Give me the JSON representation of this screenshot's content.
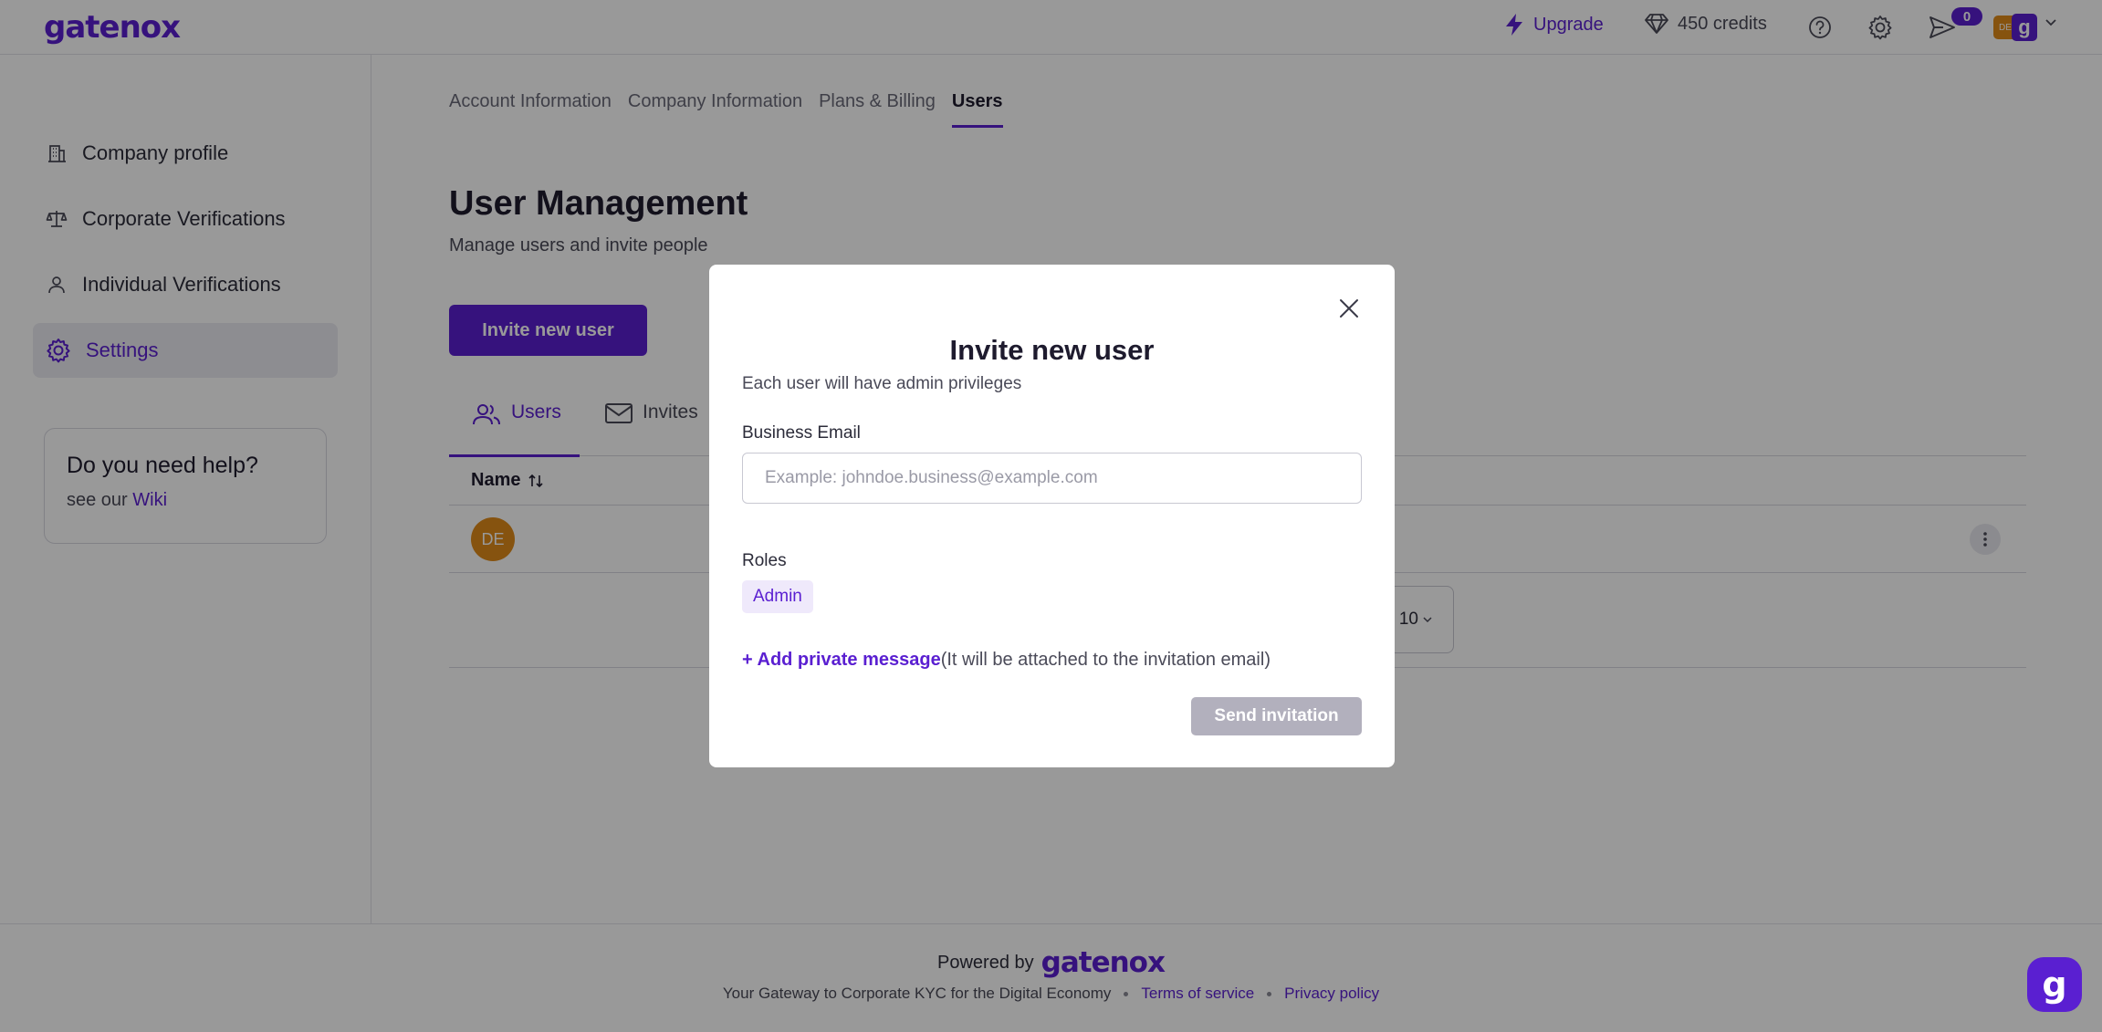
{
  "brand": {
    "name": "gatenox"
  },
  "topbar": {
    "upgrade_label": "Upgrade",
    "credits_label": "450 credits",
    "notification_count": "0",
    "avatar_initials": "DE",
    "avatar_brand_letter": "g"
  },
  "sidebar": {
    "items": [
      {
        "label": "Company profile",
        "icon": "building-icon",
        "active": false
      },
      {
        "label": "Corporate Verifications",
        "icon": "scale-icon",
        "active": false
      },
      {
        "label": "Individual Verifications",
        "icon": "user-icon",
        "active": false
      },
      {
        "label": "Settings",
        "icon": "gear-icon",
        "active": true
      }
    ],
    "help": {
      "title": "Do you need help?",
      "prefix": "see our",
      "link": "Wiki"
    }
  },
  "main": {
    "tabs": [
      "Account Information",
      "Company Information",
      "Plans & Billing",
      "Users"
    ],
    "active_tab": "Users",
    "title": "User Management",
    "subtitle": "Manage users and invite people",
    "invite_button": "Invite new user",
    "sub_tabs": [
      "Users",
      "Invites"
    ],
    "table": {
      "columns": [
        "Name"
      ],
      "rows": [
        {
          "avatar_initials": "DE"
        }
      ]
    },
    "per_page": "10"
  },
  "modal": {
    "title": "Invite new user",
    "subtitle": "Each user will have admin privileges",
    "email_label": "Business Email",
    "email_placeholder": "Example: johndoe.business@example.com",
    "email_value": "",
    "roles_label": "Roles",
    "role": "Admin",
    "private_message_link": "+ Add private message",
    "private_message_note": "(It will be attached to the invitation email)",
    "send_button": "Send invitation"
  },
  "footer": {
    "powered_by": "Powered by",
    "tagline": "Your Gateway to Corporate KYC for the Digital Economy",
    "terms": "Terms of service",
    "privacy": "Privacy policy"
  },
  "chat": {
    "letter": "g"
  },
  "colors": {
    "brand": "#5a1fd1",
    "avatar_orange": "#e08a1a",
    "disabled_button": "#b2b0bd",
    "overlay": "rgba(0,0,0,0.40)"
  }
}
